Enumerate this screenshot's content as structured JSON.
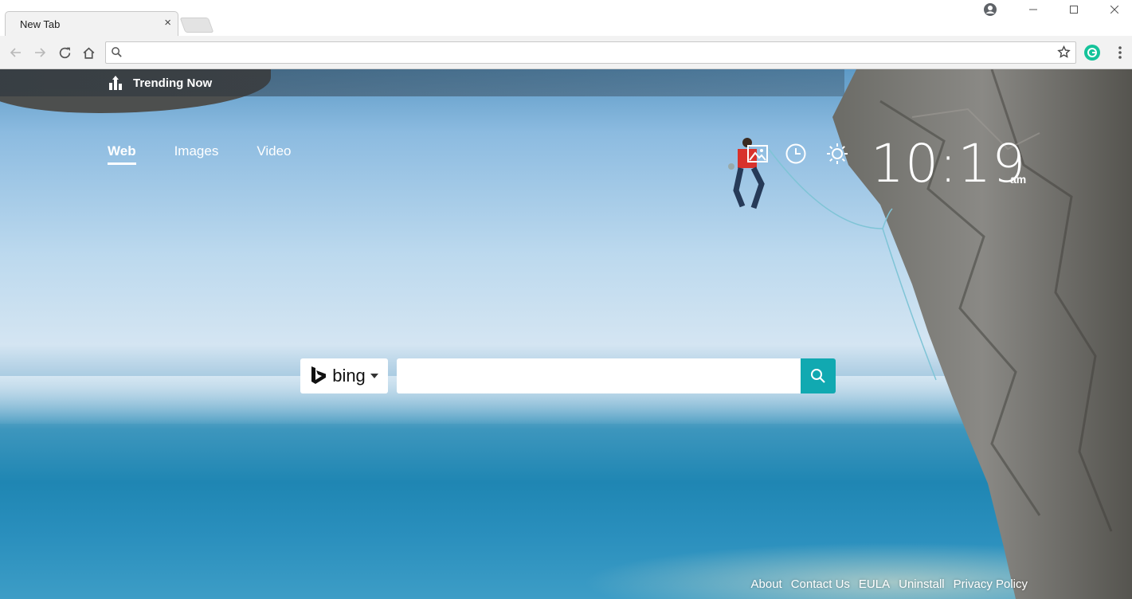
{
  "browser": {
    "tab_title": "New Tab",
    "tab_close": "×",
    "address_placeholder": ""
  },
  "trending": {
    "label": "Trending Now"
  },
  "nav": {
    "tabs": [
      "Web",
      "Images",
      "Video"
    ],
    "active": "Web"
  },
  "clock": {
    "time": "10:19",
    "ampm": "am"
  },
  "search": {
    "engine": "bing",
    "placeholder": ""
  },
  "footer": {
    "links": [
      "About",
      "Contact Us",
      "EULA",
      "Uninstall",
      "Privacy Policy"
    ]
  },
  "colors": {
    "accent": "#11a9b1",
    "extension": "#15c39a"
  }
}
